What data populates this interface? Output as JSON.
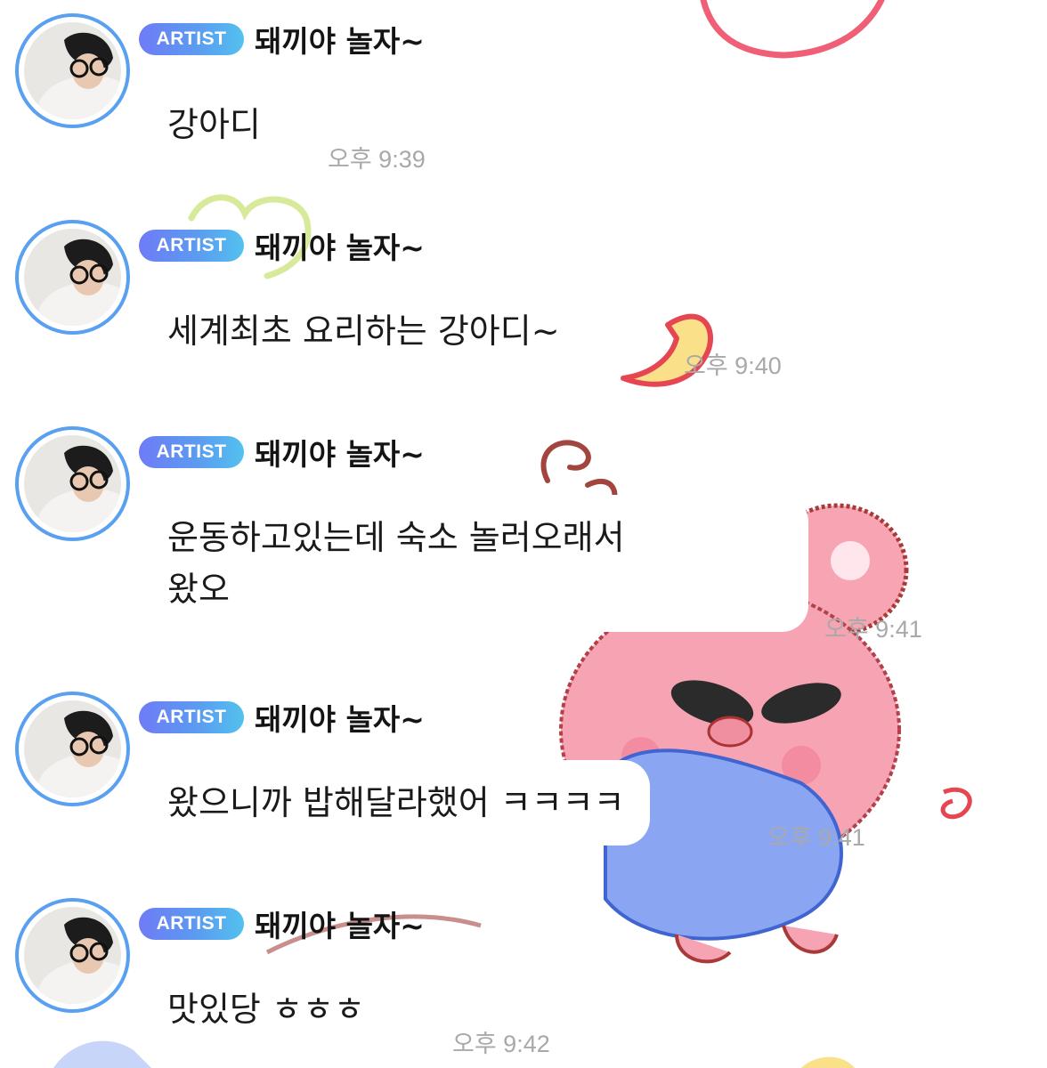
{
  "chat": {
    "messages": [
      {
        "badge": "ARTIST",
        "sender": "돼끼야 놀자~",
        "lines": [
          "강아디"
        ],
        "time": "오후 9:39"
      },
      {
        "badge": "ARTIST",
        "sender": "돼끼야 놀자~",
        "lines": [
          "세계최초 요리하는 강아디~"
        ],
        "time": "오후 9:40"
      },
      {
        "badge": "ARTIST",
        "sender": "돼끼야 놀자~",
        "lines": [
          "운동하고있는데 숙소 놀러오래서",
          "왔오"
        ],
        "time": "오후 9:41"
      },
      {
        "badge": "ARTIST",
        "sender": "돼끼야 놀자~",
        "lines": [
          "왔으니까 밥해달라했어 ㅋㅋㅋㅋ"
        ],
        "time": "오후 9:41"
      },
      {
        "badge": "ARTIST",
        "sender": "돼끼야 놀자~",
        "lines": [
          "맛있당 ㅎㅎㅎ"
        ],
        "time": "오후 9:42"
      }
    ]
  },
  "colors": {
    "avatar_ring": "#5aa0f0",
    "badge_gradient_start": "#6f7bf6",
    "badge_gradient_end": "#53c1ee",
    "timestamp": "#a9a9a9",
    "background": "#ffffff"
  },
  "icons": {
    "avatar": "profile-photo",
    "background_art": "pink-pig-character-wallpaper"
  }
}
